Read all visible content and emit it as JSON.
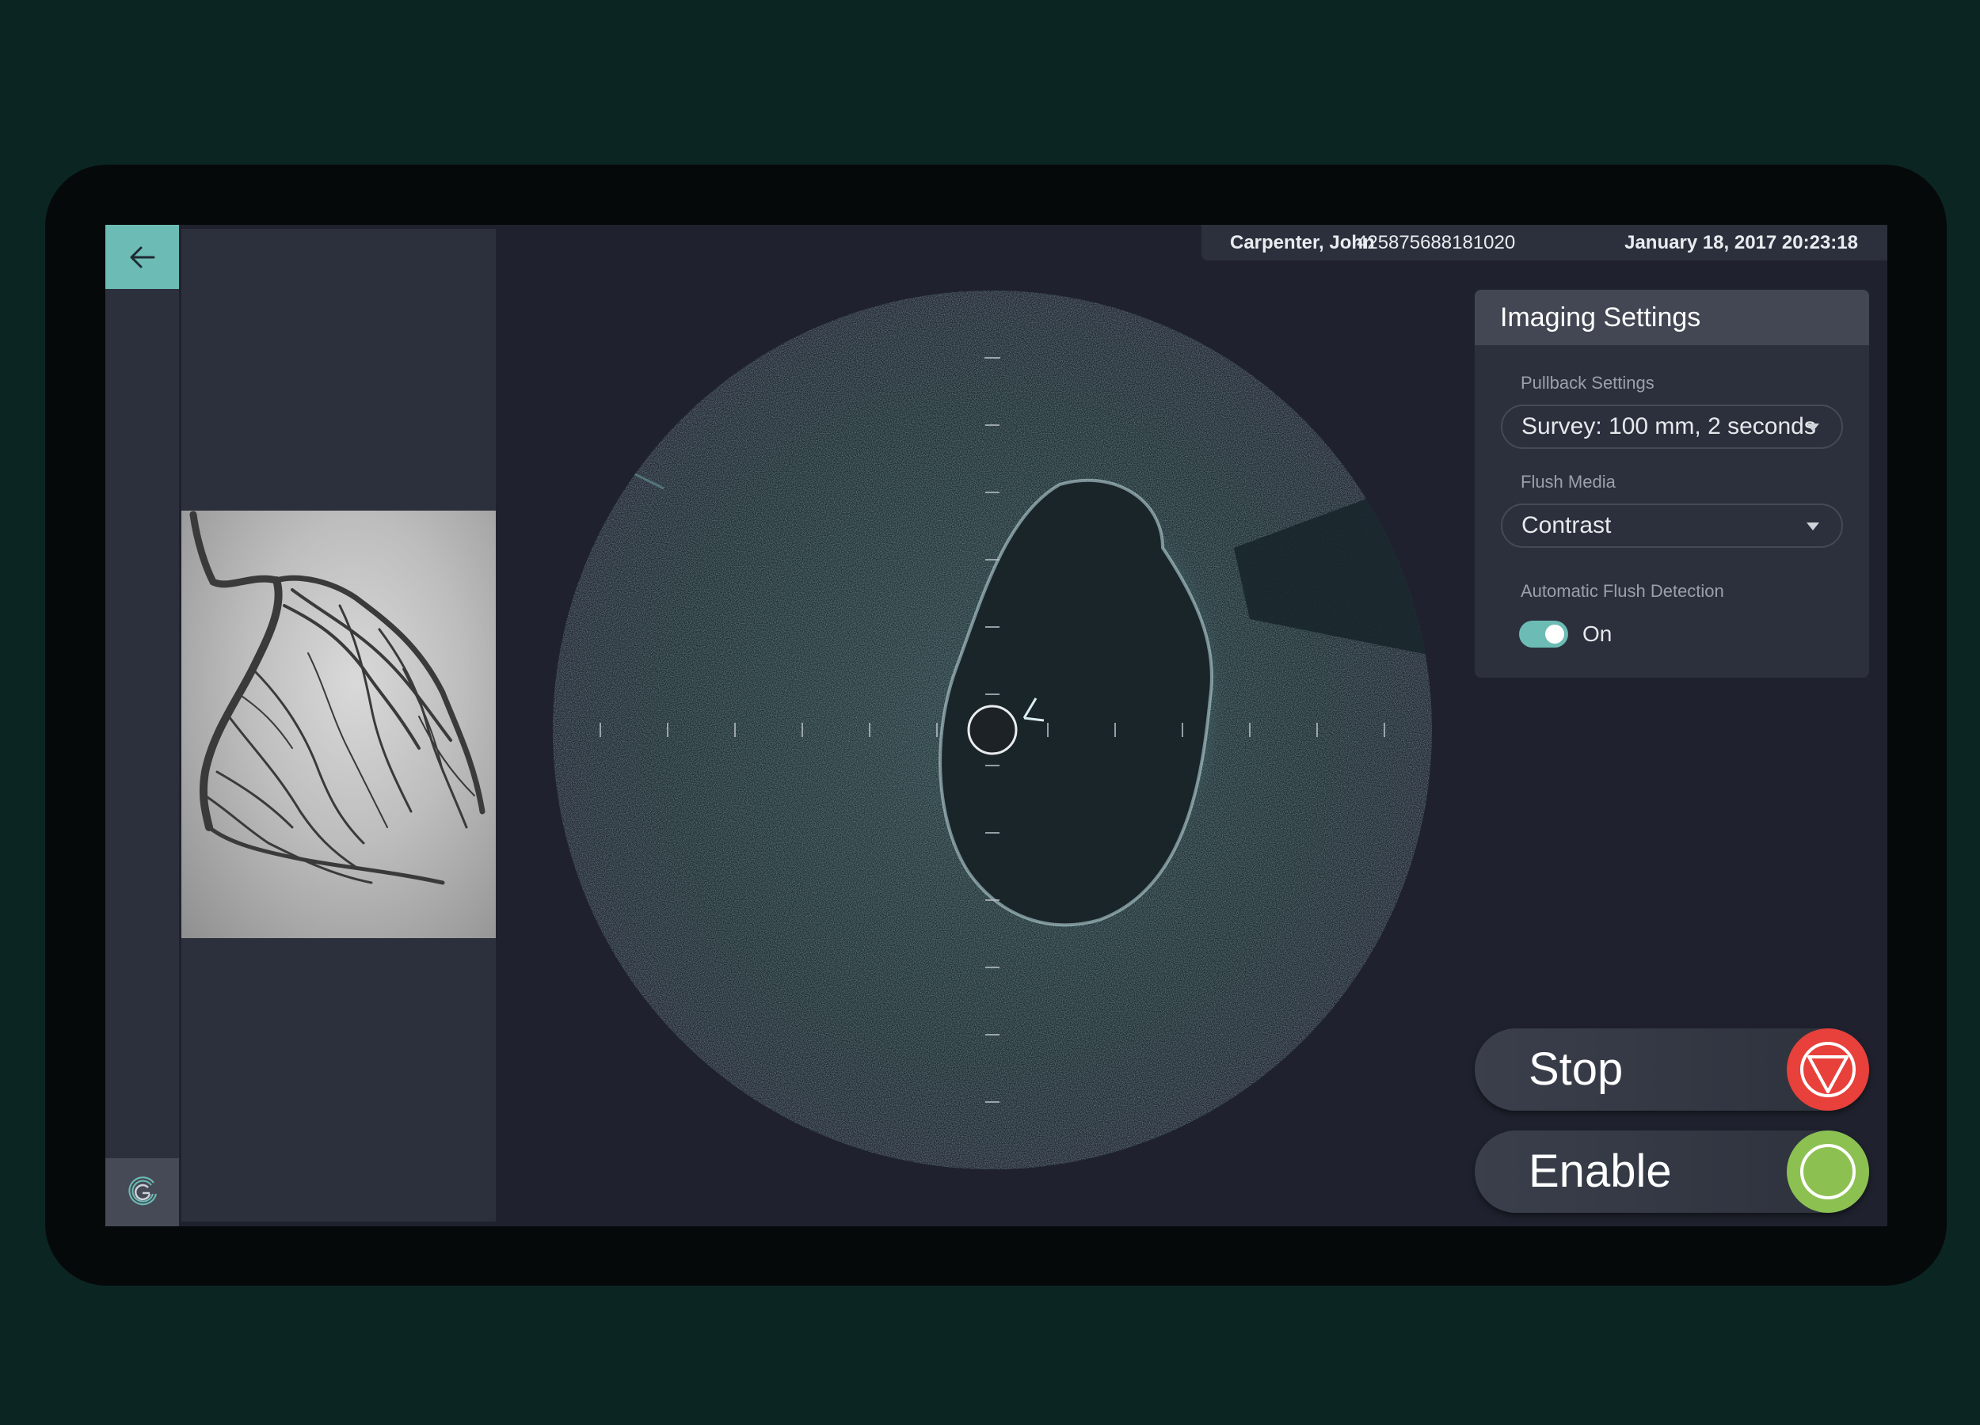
{
  "header": {
    "patient_name": "Carpenter, John",
    "patient_id": "425875688181020",
    "datetime": "January 18, 2017 20:23:18"
  },
  "nav": {
    "back_icon": "arrow-left-icon",
    "logo_icon": "app-logo-icon"
  },
  "settings": {
    "title": "Imaging Settings",
    "pullback_label": "Pullback Settings",
    "pullback_value": "Survey: 100 mm, 2 seconds",
    "flush_label": "Flush Media",
    "flush_value": "Contrast",
    "auto_flush_label": "Automatic Flush Detection",
    "auto_flush_state": "On",
    "auto_flush_enabled": true
  },
  "actions": {
    "stop_label": "Stop",
    "enable_label": "Enable"
  },
  "colors": {
    "accent": "#6cbcb5",
    "stop": "#e8403a",
    "enable": "#8cc152",
    "background": "#0b2622",
    "screen": "#1f222e"
  }
}
